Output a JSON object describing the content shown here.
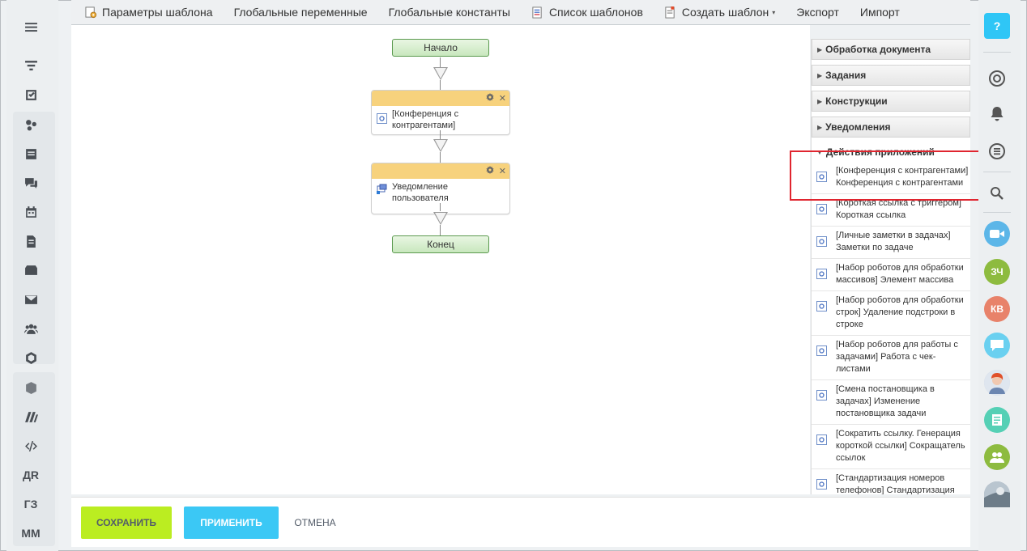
{
  "toolbar": {
    "items": [
      {
        "label": "Параметры шаблона",
        "icon": "template-settings-icon"
      },
      {
        "label": "Глобальные переменные",
        "icon": ""
      },
      {
        "label": "Глобальные константы",
        "icon": ""
      },
      {
        "label": "Список шаблонов",
        "icon": "template-list-icon"
      },
      {
        "label": "Создать шаблон",
        "icon": "create-template-icon",
        "caret": "▾"
      },
      {
        "label": "Экспорт",
        "icon": ""
      },
      {
        "label": "Импорт",
        "icon": ""
      }
    ]
  },
  "left_sidebar": {
    "items": [
      {
        "name": "menu-icon",
        "text": ""
      },
      {
        "name": "filter-icon",
        "text": ""
      },
      {
        "name": "tasks-icon",
        "text": ""
      },
      {
        "name": "crm-icon",
        "text": ""
      },
      {
        "name": "feed-icon",
        "text": ""
      },
      {
        "name": "chat-icon",
        "text": ""
      },
      {
        "name": "calendar-icon",
        "text": ""
      },
      {
        "name": "document-icon",
        "text": ""
      },
      {
        "name": "drive-icon",
        "text": ""
      },
      {
        "name": "mail-icon",
        "text": ""
      },
      {
        "name": "employees-icon",
        "text": ""
      },
      {
        "name": "hexagon-icon",
        "text": ""
      },
      {
        "name": "cube-icon",
        "text": ""
      },
      {
        "name": "marketplace-icon",
        "text": ""
      },
      {
        "name": "code-icon",
        "text": ""
      },
      {
        "name": "shortcut-dr",
        "text": "ДR"
      },
      {
        "name": "shortcut-gz",
        "text": "ГЗ"
      },
      {
        "name": "shortcut-mm",
        "text": "ММ"
      }
    ]
  },
  "workflow": {
    "start_label": "Начало",
    "end_label": "Конец",
    "blocks": [
      {
        "label": "[Конференция с контрагентами]",
        "icon": "app-action-icon"
      },
      {
        "label": "Уведомление пользователя",
        "icon": "notification-icon"
      }
    ],
    "header_colors": {
      "block": "#f7d27d",
      "start_end": "#c8e7bd"
    }
  },
  "palette": {
    "sections": [
      {
        "label": "Обработка документа",
        "expanded": false
      },
      {
        "label": "Задания",
        "expanded": false
      },
      {
        "label": "Конструкции",
        "expanded": false
      },
      {
        "label": "Уведомления",
        "expanded": false
      }
    ],
    "open_section": {
      "label": "Действия приложений",
      "expanded": true
    },
    "items": [
      {
        "label": "[Конференция с контрагентами] Конференция с контрагентами"
      },
      {
        "label": "[Короткая ссылка с триггером] Короткая ссылка"
      },
      {
        "label": "[Личные заметки в задачах] Заметки по задаче"
      },
      {
        "label": "[Набор роботов для обработки массивов] Элемент массива"
      },
      {
        "label": "[Набор роботов для обработки строк] Удаление подстроки в строке"
      },
      {
        "label": "[Набор роботов для работы с задачами] Работа с чек-листами"
      },
      {
        "label": "[Смена постановщика в задачах] Изменение постановщика задачи"
      },
      {
        "label": "[Сократить ссылку. Генерация короткой ссылки] Сокращатель ссылок"
      },
      {
        "label": "[Стандартизация номеров телефонов] Стандартизация номеров телефонов"
      }
    ]
  },
  "bottom_bar": {
    "save_label": "СОХРАНИТЬ",
    "apply_label": "ПРИМЕНИТЬ",
    "cancel_label": "ОТМЕНА",
    "save_color": "#bbed21",
    "apply_color": "#3bc8f5"
  },
  "right_sidebar": {
    "help_label": "?",
    "avatars": [
      {
        "name": "avatar-zch",
        "text": "ЗЧ",
        "color": "#8dbb3f"
      },
      {
        "name": "avatar-kv",
        "text": "КВ",
        "color": "#e8826a"
      }
    ],
    "accent_color": "#2fc6f6"
  }
}
